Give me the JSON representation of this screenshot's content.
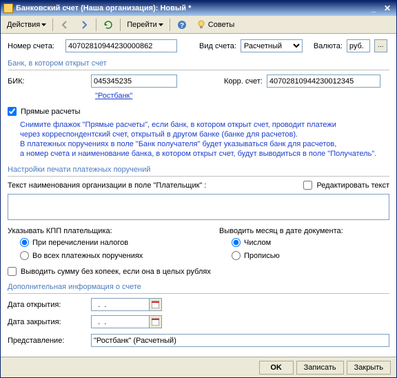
{
  "title": "Банковский счет (Наша организация): Новый *",
  "toolbar": {
    "actions": "Действия",
    "goto": "Перейти",
    "tips": "Советы"
  },
  "fields": {
    "account_no_lbl": "Номер счета:",
    "account_no": "40702810944230000862",
    "account_type_lbl": "Вид счета:",
    "account_type": "Расчетный",
    "currency_lbl": "Валюта:",
    "currency": "руб.",
    "bik_lbl": "БИК:",
    "bik": "045345235",
    "corr_lbl": "Корр. счет:",
    "corr": "40702810944230012345",
    "bank_link": "\"Ростбанк\"",
    "direct_cb": "Прямые расчеты",
    "payer_text_lbl": "Текст наименования организации в поле \"Плательщик\" :",
    "edit_text_cb": "Редактировать текст",
    "kpp_lbl": "Указывать КПП плательщика:",
    "kpp_opt1": "При перечислении налогов",
    "kpp_opt2": "Во всех платежных поручениях",
    "month_lbl": "Выводить месяц в дате документа:",
    "month_opt1": "Числом",
    "month_opt2": "Прописью",
    "no_kopecks_cb": "Выводить сумму без копеек, если она в целых рублях",
    "open_date_lbl": "Дата открытия:",
    "close_date_lbl": "Дата закрытия:",
    "open_date": "  .  .    ",
    "close_date": "  .  .    ",
    "repr_lbl": "Представление:",
    "repr": "\"Ростбанк\" (Расчетный)"
  },
  "sections": {
    "bank": "Банк, в котором открыт счет",
    "print": "Настройки печати платежных поручений",
    "extra": "Дополнительная информация о счете"
  },
  "hint": {
    "l1": "Снимите флажок \"Прямые расчеты\", если банк, в котором открыт счет, проводит платежи",
    "l2": "через корреспондентский счет, открытый в другом банке (банке для расчетов).",
    "l3": "В платежных поручениях в поле \"Банк получателя\" будет указываться банк для расчетов,",
    "l4": "а номер счета и наименование банка, в котором открыт счет, будут выводиться в поле \"Получатель\"."
  },
  "buttons": {
    "ok": "OK",
    "save": "Записать",
    "close": "Закрыть"
  }
}
